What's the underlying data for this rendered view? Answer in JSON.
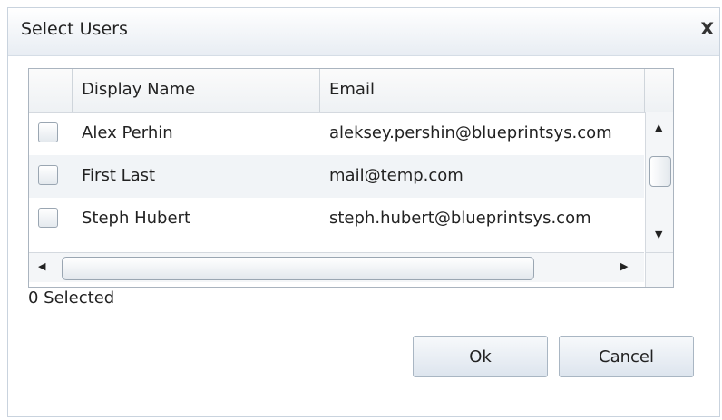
{
  "dialog": {
    "title": "Select Users",
    "close_label": "X"
  },
  "grid": {
    "columns": [
      "Display Name",
      "Email"
    ],
    "rows": [
      {
        "name": "Alex Perhin",
        "email": "aleksey.pershin@blueprintsys.com",
        "checked": false
      },
      {
        "name": "First Last",
        "email": "mail@temp.com",
        "checked": false
      },
      {
        "name": "Steph Hubert",
        "email": "steph.hubert@blueprintsys.com",
        "checked": false
      }
    ],
    "scroll_up": "▲",
    "scroll_down": "▼",
    "scroll_left": "◀",
    "scroll_right": "▶"
  },
  "status": {
    "selected_count": "0 Selected"
  },
  "buttons": {
    "ok": "Ok",
    "cancel": "Cancel"
  }
}
